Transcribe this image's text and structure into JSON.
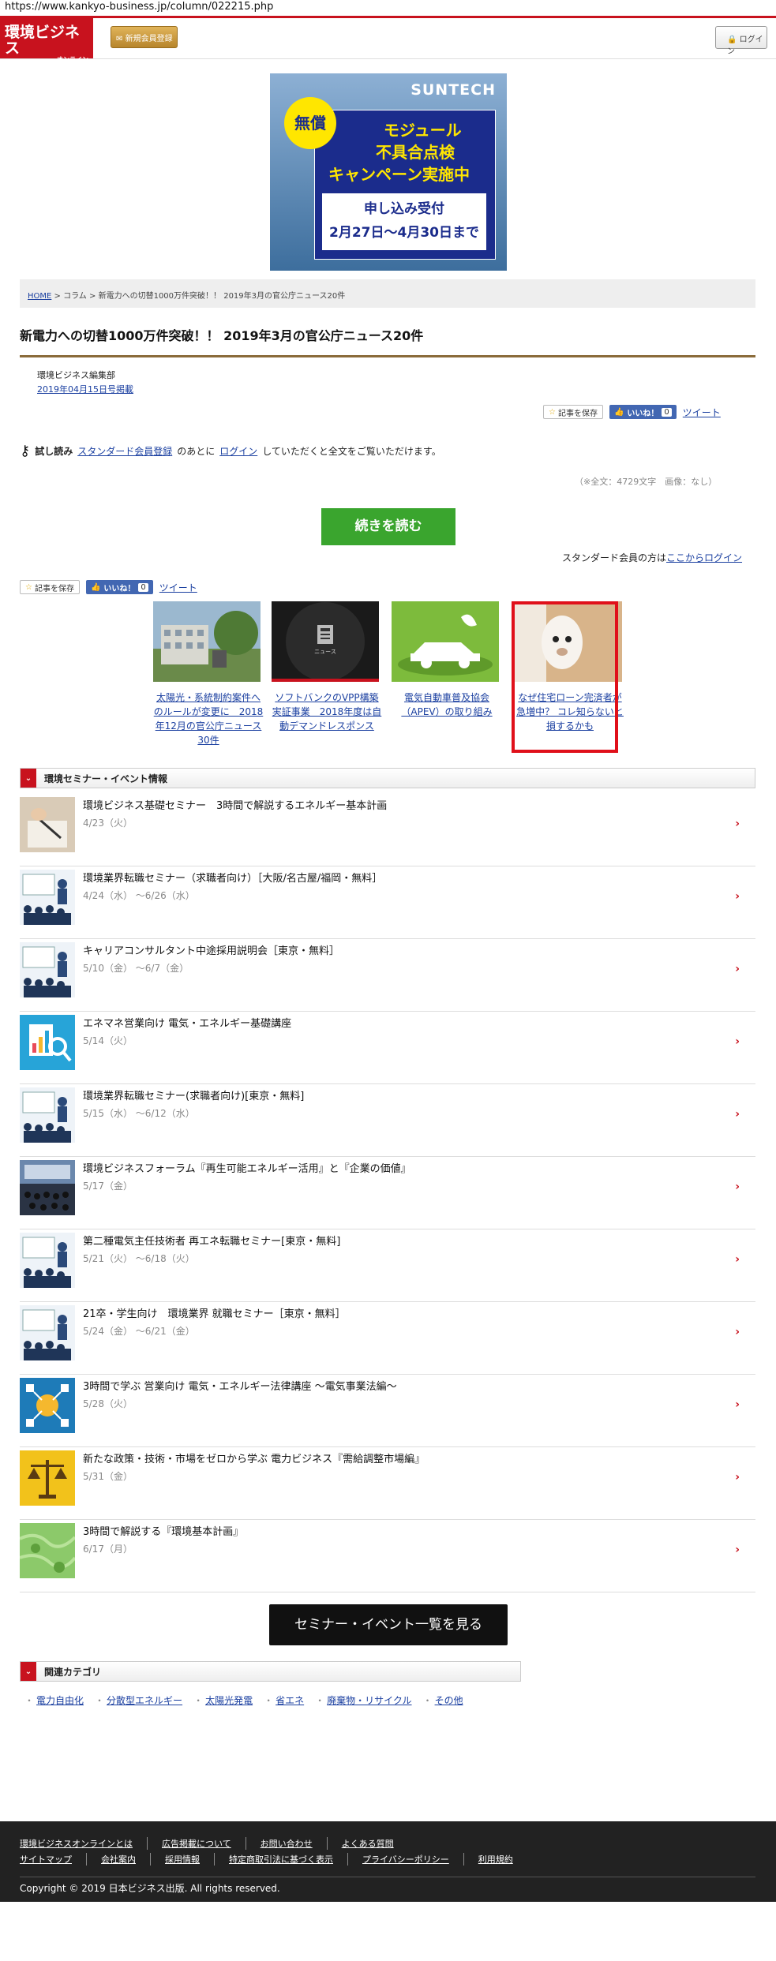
{
  "browser": {
    "url": "https://www.kankyo-business.jp/column/022215.php"
  },
  "header": {
    "logo_text": "環境ビジネス",
    "logo_sub": "オンライン",
    "register_label": "新規会員登録",
    "login_label": "ログイン"
  },
  "banner": {
    "brand": "SUNTECH",
    "badge": "無償",
    "line1": "モジュール",
    "line2": "不具合点検",
    "line3": "キャンペーン実施中",
    "apply1": "申し込み受付",
    "apply2": "2月27日～4月30日まで"
  },
  "breadcrumb": {
    "home": "HOME",
    "sep": ">",
    "column": "コラム",
    "current": "新電力への切替1000万件突破！！ 2019年3月の官公庁ニュース20件"
  },
  "article": {
    "title": "新電力への切替1000万件突破！！ 2019年3月の官公庁ニュース20件",
    "author": "環境ビジネス編集部",
    "date": "2019年04月15日号掲載",
    "trial_label": "試し読み",
    "trial_text_1": "スタンダード会員登録",
    "trial_text_2": "のあとに",
    "trial_text_3": "ログイン",
    "trial_text_4": "していただくと全文をご覧いただけます。",
    "wordcount": "（※全文：4729文字　画像：なし）",
    "read_more": "続きを読む",
    "std_login_prefix": "スタンダード会員の方は",
    "std_login_link": "ここからログイン"
  },
  "social": {
    "save": "記事を保存",
    "like": "いいね！",
    "like_count": "0",
    "tweet": "ツイート"
  },
  "related": [
    {
      "caption": "太陽光・系統制約案件へのルールが変更に　2018年12月の官公庁ニュース30件"
    },
    {
      "caption": "ソフトバンクのVPP構築実証事業　2018年度は自動デマンドレスポンス"
    },
    {
      "caption": "電気自動車普及協会（APEV）の取り組み"
    },
    {
      "caption": "なぜ住宅ローン完済者が急増中？ コレ知らないと損するかも"
    }
  ],
  "related_thumb_label": "ニュース",
  "seminar_section": {
    "title": "環境セミナー・イベント情報",
    "events": [
      {
        "title": "環境ビジネス基礎セミナー　3時間で解説するエネルギー基本計画",
        "date": "4/23（火）"
      },
      {
        "title": "環境業界転職セミナー（求職者向け）［大阪/名古屋/福岡・無料］",
        "date": "4/24（水） ～6/26（水）"
      },
      {
        "title": "キャリアコンサルタント中途採用説明会［東京・無料］",
        "date": "5/10（金） ～6/7（金）"
      },
      {
        "title": "エネマネ営業向け 電気・エネルギー基礎講座",
        "date": "5/14（火）"
      },
      {
        "title": "環境業界転職セミナー(求職者向け)[東京・無料]",
        "date": "5/15（水） ～6/12（水）"
      },
      {
        "title": "環境ビジネスフォーラム『再生可能エネルギー活用』と『企業の価値』",
        "date": "5/17（金）"
      },
      {
        "title": "第二種電気主任技術者 再エネ転職セミナー[東京・無料]",
        "date": "5/21（火） ～6/18（火）"
      },
      {
        "title": "21卒・学生向け　環境業界 就職セミナー［東京・無料］",
        "date": "5/24（金） ～6/21（金）"
      },
      {
        "title": "3時間で学ぶ 営業向け 電気・エネルギー法律講座 ～電気事業法編～",
        "date": "5/28（火）"
      },
      {
        "title": "新たな政策・技術・市場をゼロから学ぶ 電力ビジネス『需給調整市場編』",
        "date": "5/31（金）"
      },
      {
        "title": "3時間で解説する『環境基本計画』",
        "date": "6/17（月）"
      }
    ],
    "all_button": "セミナー・イベント一覧を見る"
  },
  "category_section": {
    "title": "関連カテゴリ",
    "items": [
      "電力自由化",
      "分散型エネルギー",
      "太陽光発電",
      "省エネ",
      "廃棄物・リサイクル",
      "その他"
    ]
  },
  "footer": {
    "row1": [
      "環境ビジネスオンラインとは",
      "広告掲載について",
      "お問い合わせ",
      "よくある質問"
    ],
    "row2": [
      "サイトマップ",
      "会社案内",
      "採用情報",
      "特定商取引法に基づく表示",
      "プライバシーポリシー",
      "利用規約"
    ],
    "copyright": "Copyright © 2019 日本ビジネス出版. All rights reserved."
  },
  "colors": {
    "brand_red": "#c8121e",
    "link_blue": "#1a3fa0",
    "read_green": "#3aa52e"
  }
}
